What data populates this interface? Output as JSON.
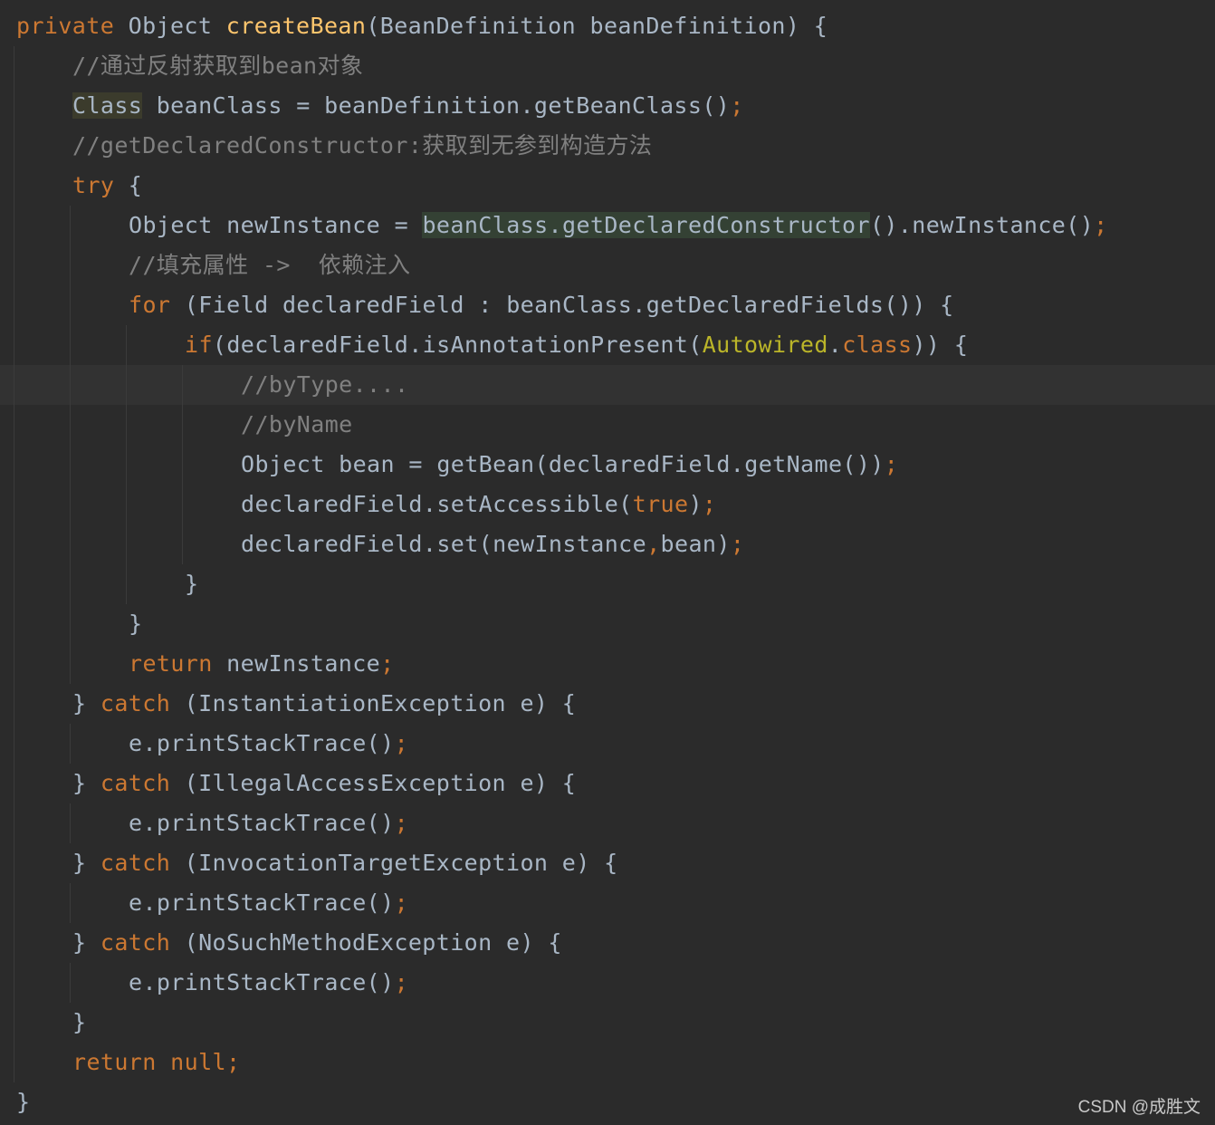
{
  "editor": {
    "theme": "darcula",
    "colors": {
      "background": "#2b2b2b",
      "default_text": "#a9b7c6",
      "keyword": "#cc7832",
      "method_declaration": "#ffc66d",
      "comment": "#808080",
      "annotation": "#bbb529",
      "usage_highlight": "#344134",
      "current_line": "#323232"
    },
    "lines": [
      {
        "indent": 0,
        "tokens": [
          {
            "t": "private",
            "k": "kw"
          },
          {
            "t": " Object ",
            "k": "plain"
          },
          {
            "t": "createBean",
            "k": "fn"
          },
          {
            "t": "(BeanDefinition beanDefinition) {",
            "k": "plain"
          }
        ]
      },
      {
        "indent": 1,
        "tokens": [
          {
            "t": "//通过反射获取到bean对象",
            "k": "cm"
          }
        ]
      },
      {
        "indent": 1,
        "tokens": [
          {
            "t": "Class",
            "k": "hl-class"
          },
          {
            "t": " beanClass = beanDefinition.getBeanClass()",
            "k": "plain"
          },
          {
            "t": ";",
            "k": "kw"
          }
        ]
      },
      {
        "indent": 1,
        "tokens": [
          {
            "t": "//getDeclaredConstructor:获取到无参到构造方法",
            "k": "cm"
          }
        ]
      },
      {
        "indent": 1,
        "tokens": [
          {
            "t": "try",
            "k": "kw"
          },
          {
            "t": " {",
            "k": "plain"
          }
        ]
      },
      {
        "indent": 2,
        "tokens": [
          {
            "t": "Object newInstance = ",
            "k": "plain"
          },
          {
            "t": "beanClass.getDeclaredConstructor",
            "k": "hl-usage"
          },
          {
            "t": "().newInstance()",
            "k": "plain"
          },
          {
            "t": ";",
            "k": "kw"
          }
        ]
      },
      {
        "indent": 2,
        "tokens": [
          {
            "t": "//填充属性 ->  依赖注入",
            "k": "cm"
          }
        ]
      },
      {
        "indent": 2,
        "tokens": [
          {
            "t": "for",
            "k": "kw"
          },
          {
            "t": " (Field declaredField : beanClass.getDeclaredFields()) {",
            "k": "plain"
          }
        ]
      },
      {
        "indent": 3,
        "tokens": [
          {
            "t": "if",
            "k": "kw"
          },
          {
            "t": "(declaredField.isAnnotationPresent(",
            "k": "plain"
          },
          {
            "t": "Autowired",
            "k": "an"
          },
          {
            "t": ".",
            "k": "plain"
          },
          {
            "t": "class",
            "k": "kw"
          },
          {
            "t": ")) {",
            "k": "plain"
          }
        ]
      },
      {
        "indent": 4,
        "current": true,
        "tokens": [
          {
            "t": "//byType....",
            "k": "cm"
          }
        ]
      },
      {
        "indent": 4,
        "tokens": [
          {
            "t": "//byName",
            "k": "cm"
          }
        ]
      },
      {
        "indent": 4,
        "tokens": [
          {
            "t": "Object bean = getBean(declaredField.getName())",
            "k": "plain"
          },
          {
            "t": ";",
            "k": "kw"
          }
        ]
      },
      {
        "indent": 4,
        "tokens": [
          {
            "t": "declaredField.setAccessible(",
            "k": "plain"
          },
          {
            "t": "true",
            "k": "kw"
          },
          {
            "t": ")",
            "k": "plain"
          },
          {
            "t": ";",
            "k": "kw"
          }
        ]
      },
      {
        "indent": 4,
        "tokens": [
          {
            "t": "declaredField.set(newInstance",
            "k": "plain"
          },
          {
            "t": ",",
            "k": "kw"
          },
          {
            "t": "bean)",
            "k": "plain"
          },
          {
            "t": ";",
            "k": "kw"
          }
        ]
      },
      {
        "indent": 3,
        "tokens": [
          {
            "t": "}",
            "k": "plain"
          }
        ]
      },
      {
        "indent": 2,
        "tokens": [
          {
            "t": "}",
            "k": "plain"
          }
        ]
      },
      {
        "indent": 2,
        "tokens": [
          {
            "t": "return",
            "k": "kw"
          },
          {
            "t": " newInstance",
            "k": "plain"
          },
          {
            "t": ";",
            "k": "kw"
          }
        ]
      },
      {
        "indent": 1,
        "tokens": [
          {
            "t": "} ",
            "k": "plain"
          },
          {
            "t": "catch",
            "k": "kw"
          },
          {
            "t": " (InstantiationException e) {",
            "k": "plain"
          }
        ]
      },
      {
        "indent": 2,
        "tokens": [
          {
            "t": "e.printStackTrace()",
            "k": "plain"
          },
          {
            "t": ";",
            "k": "kw"
          }
        ]
      },
      {
        "indent": 1,
        "tokens": [
          {
            "t": "} ",
            "k": "plain"
          },
          {
            "t": "catch",
            "k": "kw"
          },
          {
            "t": " (IllegalAccessException e) {",
            "k": "plain"
          }
        ]
      },
      {
        "indent": 2,
        "tokens": [
          {
            "t": "e.printStackTrace()",
            "k": "plain"
          },
          {
            "t": ";",
            "k": "kw"
          }
        ]
      },
      {
        "indent": 1,
        "tokens": [
          {
            "t": "} ",
            "k": "plain"
          },
          {
            "t": "catch",
            "k": "kw"
          },
          {
            "t": " (InvocationTargetException e) {",
            "k": "plain"
          }
        ]
      },
      {
        "indent": 2,
        "tokens": [
          {
            "t": "e.printStackTrace()",
            "k": "plain"
          },
          {
            "t": ";",
            "k": "kw"
          }
        ]
      },
      {
        "indent": 1,
        "tokens": [
          {
            "t": "} ",
            "k": "plain"
          },
          {
            "t": "catch",
            "k": "kw"
          },
          {
            "t": " (NoSuchMethodException e) {",
            "k": "plain"
          }
        ]
      },
      {
        "indent": 2,
        "tokens": [
          {
            "t": "e.printStackTrace()",
            "k": "plain"
          },
          {
            "t": ";",
            "k": "kw"
          }
        ]
      },
      {
        "indent": 1,
        "tokens": [
          {
            "t": "}",
            "k": "plain"
          }
        ]
      },
      {
        "indent": 1,
        "tokens": [
          {
            "t": "return",
            "k": "kw"
          },
          {
            "t": " ",
            "k": "plain"
          },
          {
            "t": "null",
            "k": "kw"
          },
          {
            "t": ";",
            "k": "kw"
          }
        ]
      },
      {
        "indent": 0,
        "tokens": [
          {
            "t": "}",
            "k": "plain"
          }
        ]
      }
    ]
  },
  "watermark": {
    "text": "CSDN @成胜文"
  }
}
